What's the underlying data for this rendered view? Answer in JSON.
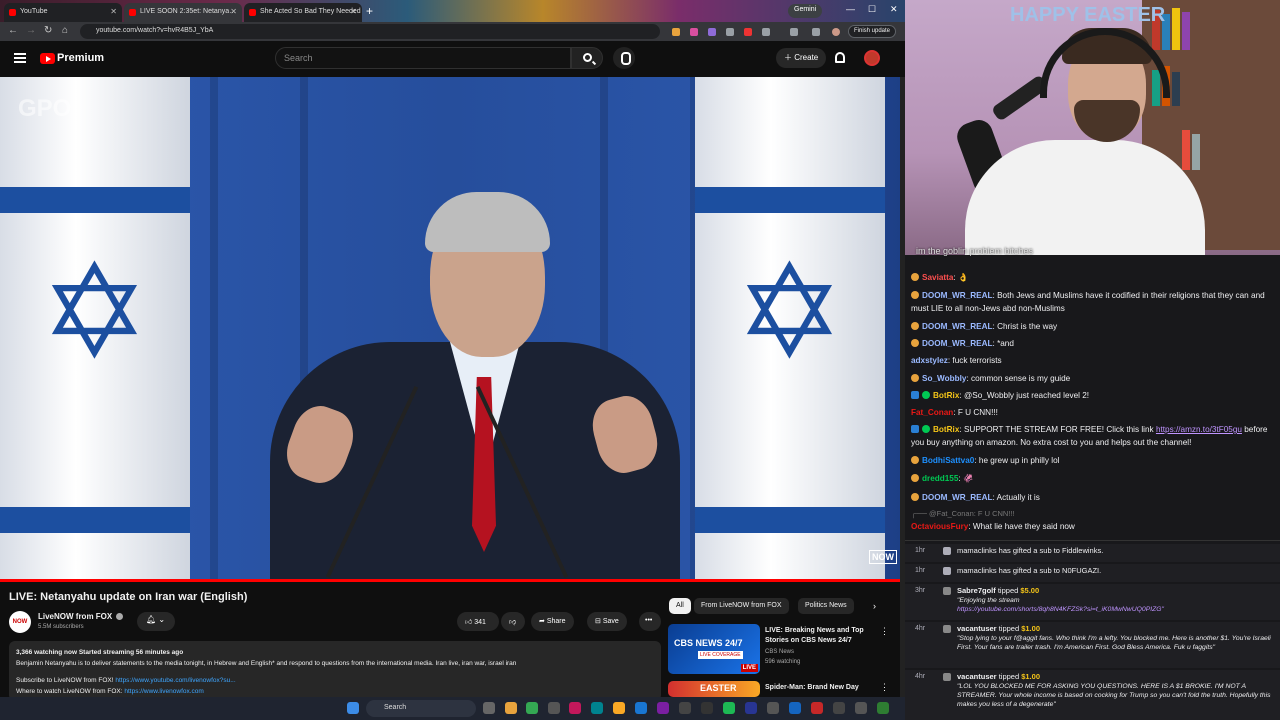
{
  "browser": {
    "tabs": [
      {
        "label": "YouTube"
      },
      {
        "label": "LIVE SOON 2:35et: Netanya…"
      },
      {
        "label": "She Acted So Bad They Needed"
      }
    ],
    "gemini_label": "Gemini",
    "url": "youtube.com/watch?v=hvR4B5J_YbA",
    "finish_update_label": "Finish update"
  },
  "youtube": {
    "brand": "Premium",
    "search_placeholder": "Search",
    "create_label": "Create",
    "video": {
      "watermark_left": "GPO",
      "watermark_right": "NOW",
      "title": "LIVE: Netanyahu update on Iran war (English)",
      "channel_name": "LiveNOW from FOX",
      "channel_avatar_text": "NOW",
      "subscribers": "5.5M subscribers",
      "likes": "341",
      "share_label": "Share",
      "save_label": "Save",
      "watching_line": "3,366 watching now  Started streaming 56 minutes ago",
      "description": "Benjamin Netanyahu is to deliver statements to the media tonight, in Hebrew and English* and respond to questions from the international media. Iran live, iran war, israel iran",
      "subscribe_line": "Subscribe to LiveNOW from FOX! ",
      "subscribe_link": "https://www.youtube.com/livenowfox?su...",
      "where_line": "Where to watch LiveNOW from FOX: ",
      "where_link": "https://www.livenowfox.com"
    },
    "chips": [
      "All",
      "From LiveNOW from FOX",
      "Politics News"
    ],
    "recommendations": [
      {
        "title": "LIVE: Breaking News and Top Stories on CBS News 24/7",
        "channel": "CBS News",
        "meta": "596 watching",
        "thumb_brand": "CBS NEWS 24/7",
        "thumb_badge": "LIVE COVERAGE",
        "live_label": "LIVE"
      },
      {
        "title": "Spider-Man: Brand New Day",
        "channel": "",
        "meta": "",
        "thumb_brand": "EASTER"
      }
    ]
  },
  "taskbar": {
    "search_label": "Search"
  },
  "webcam": {
    "sign_text": "HAPPY EASTER",
    "caption": "im the goblin problem bitches"
  },
  "chat": {
    "messages": [
      {
        "user": "Saviatta",
        "text": " 👌",
        "color": "#ff4f4f"
      },
      {
        "user": "DOOM_WR_REAL",
        "text": " Both Jews and Muslims have it codified in their religions that they can and must LIE to all non-Jews abd non-Muslims",
        "color": "#9ab9ff"
      },
      {
        "user": "DOOM_WR_REAL",
        "text": " Christ is the way",
        "color": "#9ab9ff"
      },
      {
        "user": "DOOM_WR_REAL",
        "text": " *and",
        "color": "#9ab9ff"
      },
      {
        "user": "adxstylez",
        "text": " fuck terrorists",
        "color": "#9ab9ff"
      },
      {
        "user": "So_Wobbly",
        "text": " common sense is my guide",
        "color": "#9ab9ff"
      },
      {
        "user": "BotRix",
        "text": " @So_Wobbly just reached level 2!",
        "color": "#f5c518"
      },
      {
        "user": "Fat_Conan",
        "text": " F U CNN!!!",
        "color": "#e91916"
      },
      {
        "user": "BotRix",
        "text": " SUPPORT THE STREAM FOR FREE! Click this link ",
        "link": "https://amzn.to/3tF05gu",
        "text2": " before you buy anything on amazon. No extra cost to you and helps out the channel!",
        "color": "#f5c518"
      },
      {
        "user": "BodhiSattva0",
        "text": " he grew up in philly lol",
        "color": "#1e90ff"
      },
      {
        "user": "dredd155",
        "text": " 🦑",
        "color": "#00c853"
      },
      {
        "user": "DOOM_WR_REAL",
        "text": " Actually it is",
        "color": "#9ab9ff"
      },
      {
        "reply": "@Fat_Conan: F U CNN!!!"
      },
      {
        "user": "OctaviousFury",
        "text": " What lie have they said now",
        "color": "#e91916"
      }
    ],
    "events": [
      {
        "time": "1hr",
        "text": "mamaclinks has gifted a sub to Fiddlewinks."
      },
      {
        "time": "1hr",
        "text": "mamaclinks has gifted a sub to N0FUGAZI."
      },
      {
        "time": "3hr",
        "user": "Sabre7golf",
        "verb": " tipped ",
        "amount": "$5.00",
        "quote": "\"Enjoying the stream",
        "quote_link": "https://youtube.com/shorts/8qh8N4KFZSk?si=t_iK0MwNwUQ0PIZG\""
      },
      {
        "time": "4hr",
        "user": "vacantuser",
        "verb": " tipped ",
        "amount": "$1.00",
        "quote": "\"Stop lying to your f@aggit fans. Who think I'm a lefty. You blocked me. Here is another $1. You're Israeli First. Your fans are trailer trash. I'm American First. God Bless America. Fuk u faggits\""
      },
      {
        "time": "4hr",
        "user": "vacantuser",
        "verb": " tipped ",
        "amount": "$1.00",
        "quote": "\"LOL YOU BLOCKED ME FOR ASKING YOU QUESTIONS. HERE IS A $1 BROKIE. I'M NOT A STREAMER. Your whole income is based on cocking for Trump so you can't fold the truth. Hopefully this makes you less of a degenerate\""
      }
    ]
  }
}
